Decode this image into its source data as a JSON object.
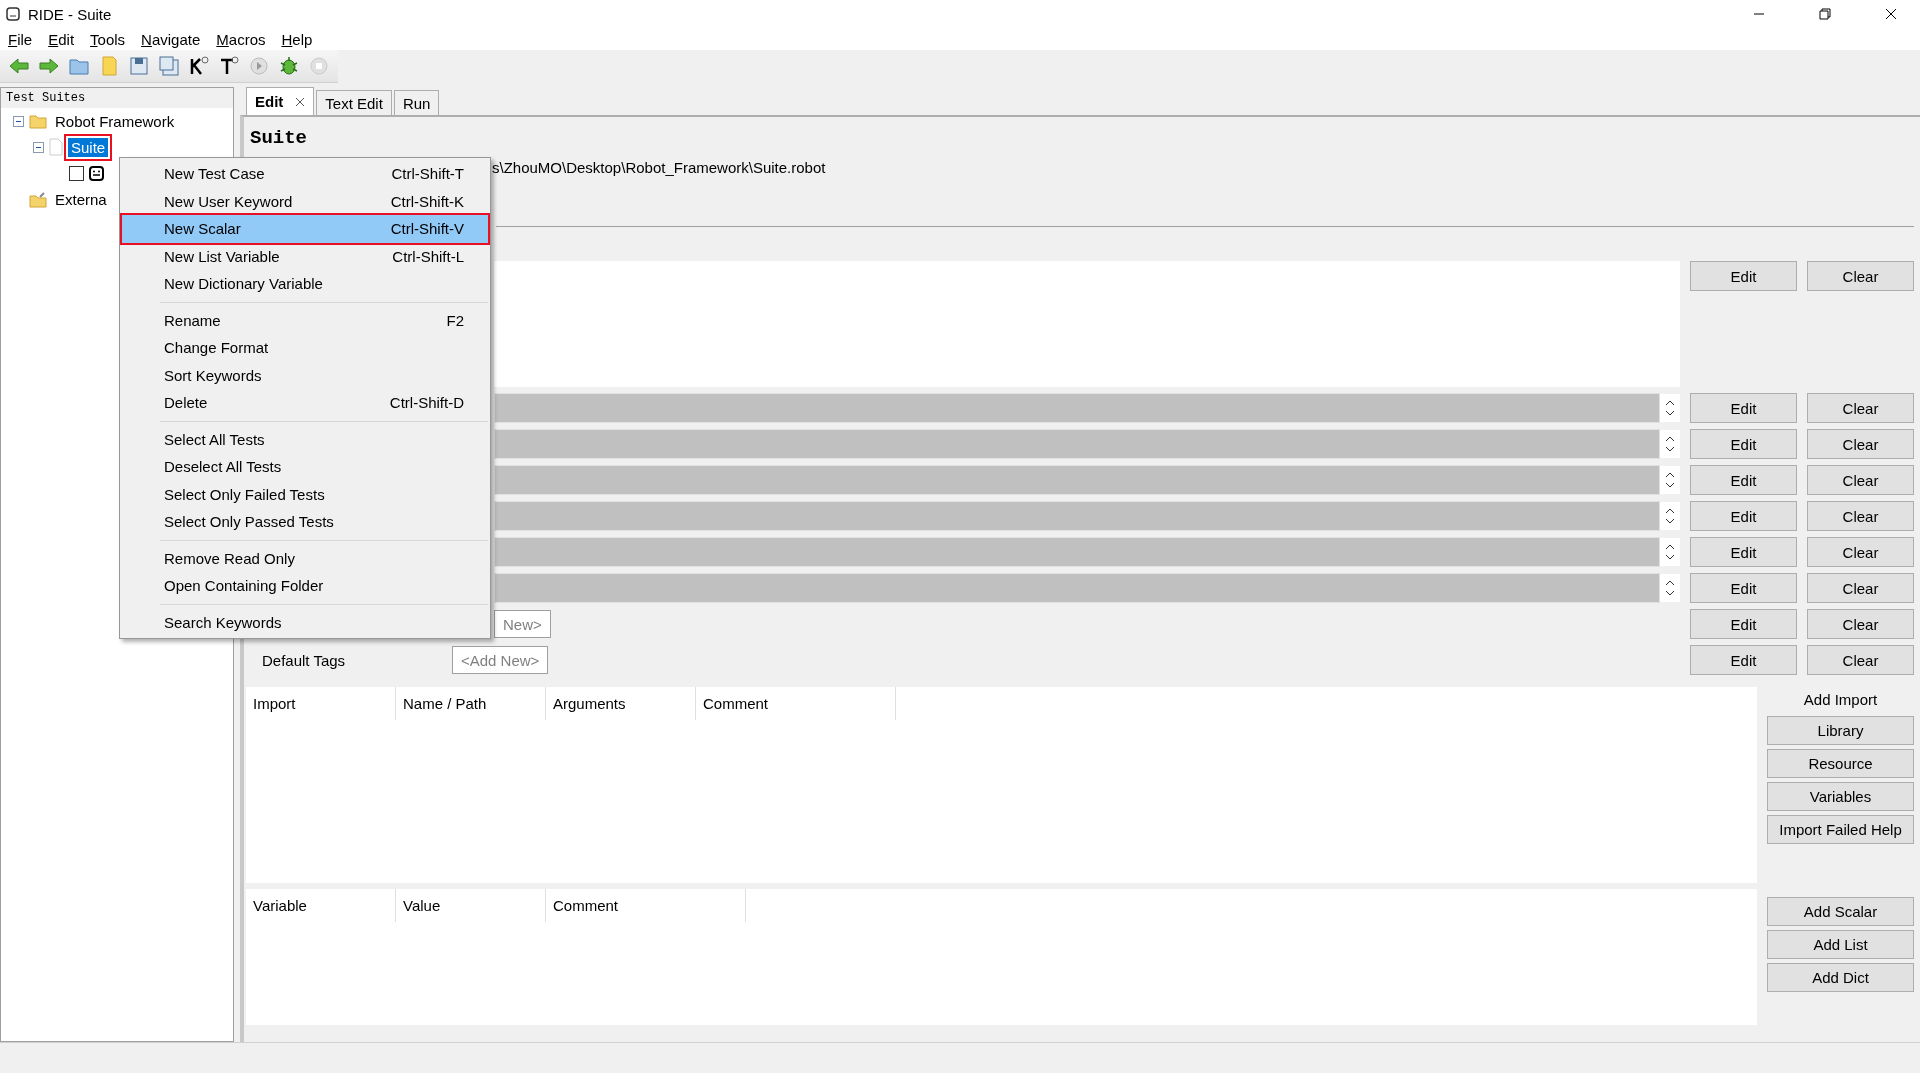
{
  "window": {
    "title": "RIDE - Suite"
  },
  "menu_bar": [
    "File",
    "Edit",
    "Tools",
    "Navigate",
    "Macros",
    "Help"
  ],
  "tree": {
    "title": "Test Suites",
    "items": [
      {
        "label": "Robot Framework",
        "kind": "folder",
        "expanded": true,
        "selected": false,
        "children": [
          {
            "label": "Suite",
            "kind": "file",
            "expanded": true,
            "selected": true,
            "children": [
              {
                "kind": "test",
                "checked": false
              }
            ]
          }
        ]
      },
      {
        "label": "Externa",
        "kind": "external",
        "selected": false
      }
    ]
  },
  "tabs": [
    {
      "label": "Edit",
      "selected": true,
      "closable": true
    },
    {
      "label": "Text Edit",
      "selected": false,
      "closable": false
    },
    {
      "label": "Run",
      "selected": false,
      "closable": false
    }
  ],
  "editor": {
    "title": "Suite",
    "source": "s\\ZhouMO\\Desktop\\Robot_Framework\\Suite.robot",
    "settings": [
      {
        "kind": "documentation",
        "buttons": [
          "Edit",
          "Clear"
        ]
      },
      {
        "kind": "field",
        "buttons": [
          "Edit",
          "Clear"
        ]
      },
      {
        "kind": "field",
        "buttons": [
          "Edit",
          "Clear"
        ]
      },
      {
        "kind": "field",
        "buttons": [
          "Edit",
          "Clear"
        ]
      },
      {
        "kind": "field",
        "buttons": [
          "Edit",
          "Clear"
        ]
      },
      {
        "kind": "field",
        "buttons": [
          "Edit",
          "Clear"
        ]
      },
      {
        "kind": "field",
        "buttons": [
          "Edit",
          "Clear"
        ]
      },
      {
        "kind": "tags",
        "value": "New>",
        "buttons": [
          "Edit",
          "Clear"
        ]
      },
      {
        "kind": "tags",
        "label": "Default Tags",
        "value": "<Add New>",
        "buttons": [
          "Edit",
          "Clear"
        ]
      }
    ]
  },
  "imports": {
    "columns": [
      "Import",
      "Name / Path",
      "Arguments",
      "Comment"
    ],
    "title": "Add Import",
    "buttons": [
      "Library",
      "Resource",
      "Variables",
      "Import Failed Help"
    ]
  },
  "variables": {
    "columns": [
      "Variable",
      "Value",
      "Comment"
    ],
    "buttons": [
      "Add Scalar",
      "Add List",
      "Add Dict"
    ]
  },
  "context_menu": {
    "groups": [
      [
        {
          "label": "New Test Case",
          "shortcut": "Ctrl-Shift-T",
          "selected": false
        },
        {
          "label": "New User Keyword",
          "shortcut": "Ctrl-Shift-K",
          "selected": false
        },
        {
          "label": "New Scalar",
          "shortcut": "Ctrl-Shift-V",
          "selected": true
        },
        {
          "label": "New List Variable",
          "shortcut": "Ctrl-Shift-L",
          "selected": false
        },
        {
          "label": "New Dictionary Variable",
          "selected": false
        }
      ],
      [
        {
          "label": "Rename",
          "shortcut": "F2",
          "selected": false
        },
        {
          "label": "Change Format",
          "selected": false
        },
        {
          "label": "Sort Keywords",
          "selected": false
        },
        {
          "label": "Delete",
          "shortcut": "Ctrl-Shift-D",
          "selected": false
        }
      ],
      [
        {
          "label": "Select All Tests",
          "selected": false
        },
        {
          "label": "Deselect All Tests",
          "selected": false
        },
        {
          "label": "Select Only Failed Tests",
          "selected": false
        },
        {
          "label": "Select Only Passed Tests",
          "selected": false
        }
      ],
      [
        {
          "label": "Remove Read Only",
          "selected": false
        },
        {
          "label": "Open Containing Folder",
          "selected": false
        }
      ],
      [
        {
          "label": "Search Keywords",
          "selected": false
        }
      ]
    ]
  }
}
